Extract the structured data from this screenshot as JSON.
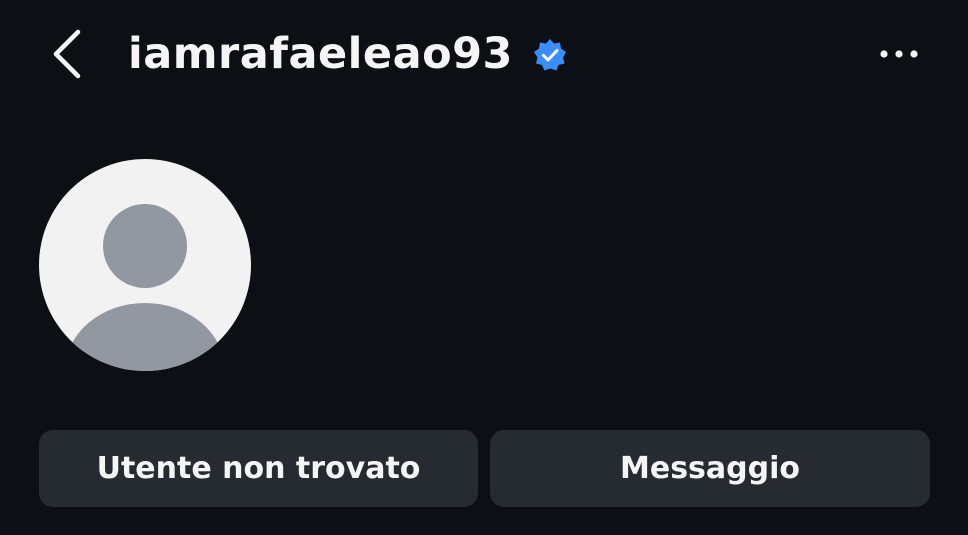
{
  "header": {
    "username": "iamrafaeleao93",
    "verified": true,
    "back_icon": "chevron-left-icon",
    "verified_icon": "verified-badge-icon",
    "more_icon": "more-horizontal-icon"
  },
  "profile": {
    "avatar_icon": "default-avatar-icon"
  },
  "actions": {
    "primary_label": "Utente non trovato",
    "secondary_label": "Messaggio"
  },
  "colors": {
    "background": "#0c1014",
    "text": "#f5f5f5",
    "button_bg": "#262b31",
    "verified_blue": "#3a8ef7",
    "avatar_bg": "#f2f2f3",
    "avatar_figure": "#9298a2"
  }
}
